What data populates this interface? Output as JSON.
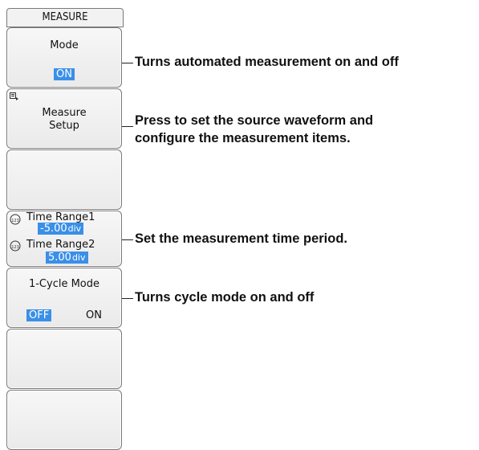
{
  "menu_title": "MEASURE",
  "keys": {
    "mode": {
      "label": "Mode",
      "value": "ON"
    },
    "setup": {
      "line1": "Measure",
      "line2": "Setup"
    },
    "time_range": {
      "label1": "Time Range1",
      "value1": "-5.00",
      "unit1": "div",
      "label2": "Time Range2",
      "value2": "5.00",
      "unit2": "div"
    },
    "cycle": {
      "label": "1-Cycle Mode",
      "off": "OFF",
      "on": "ON"
    }
  },
  "callouts": {
    "mode": "Turns automated measurement on and off",
    "setup_line1": "Press to set the source waveform and",
    "setup_line2": "configure the measurement items.",
    "time_range": "Set the measurement time period.",
    "cycle": "Turns cycle mode on and off"
  },
  "colors": {
    "highlight": "#3a8fe8",
    "border": "#7a7a7a"
  }
}
